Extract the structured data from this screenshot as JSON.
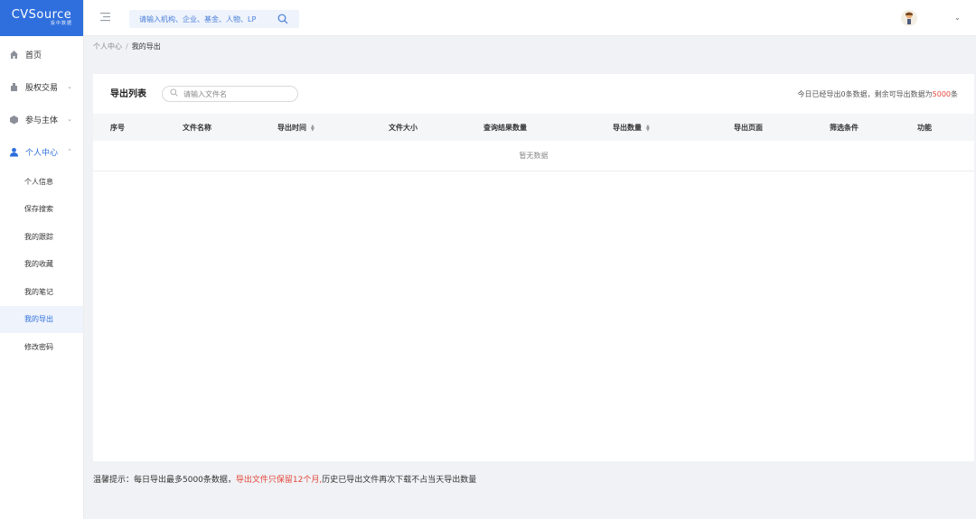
{
  "logo": {
    "main": "CVSource",
    "sub": "投中数据"
  },
  "sidebar": {
    "items": [
      {
        "label": "首页",
        "icon": "home-icon"
      },
      {
        "label": "股权交易",
        "icon": "equity-icon"
      },
      {
        "label": "参与主体",
        "icon": "participant-icon"
      },
      {
        "label": "个人中心",
        "icon": "user-icon"
      }
    ],
    "subitems": [
      "个人信息",
      "保存搜索",
      "我的跟踪",
      "我的收藏",
      "我的笔记",
      "我的导出",
      "修改密码"
    ],
    "active_subitem": "我的导出",
    "accent": "#2f6fdd"
  },
  "header": {
    "search_placeholder": "请输入机构、企业、基金、人物、LP"
  },
  "breadcrumb": {
    "parent": "个人中心",
    "separator": "/",
    "current": "我的导出"
  },
  "card": {
    "title": "导出列表",
    "file_search_placeholder": "请输入文件名",
    "quota_prefix": "今日已经导出0条数据，剩余可导出数据为",
    "quota_value": "5000",
    "quota_suffix": "条"
  },
  "table": {
    "columns": [
      "序号",
      "文件名称",
      "导出时间",
      "文件大小",
      "查询结果数量",
      "导出数量",
      "导出页面",
      "筛选条件",
      "功能"
    ],
    "empty_text": "暂无数据"
  },
  "tip": {
    "prefix": "温馨提示：每日导出最多5000条数据，",
    "warning": "导出文件只保留12个月,",
    "suffix": "历史已导出文件再次下载不占当天导出数量"
  }
}
